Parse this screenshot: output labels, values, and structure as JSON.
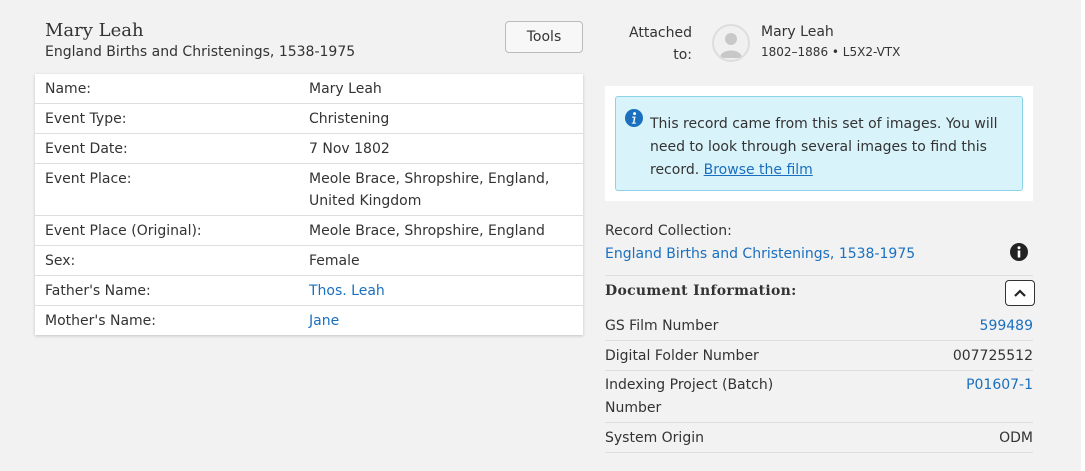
{
  "header": {
    "title": "Mary Leah",
    "subtitle": "England Births and Christenings, 1538-1975",
    "tools_label": "Tools"
  },
  "record": {
    "rows": [
      {
        "label": "Name:",
        "value": "Mary Leah"
      },
      {
        "label": "Event Type:",
        "value": "Christening"
      },
      {
        "label": "Event Date:",
        "value": "7 Nov 1802"
      },
      {
        "label": "Event Place:",
        "value": "Meole Brace, Shropshire, England, United Kingdom"
      },
      {
        "label": "Event Place (Original):",
        "value": "Meole Brace, Shropshire, England"
      },
      {
        "label": "Sex:",
        "value": "Female"
      },
      {
        "label": "Father's Name:",
        "value": "Thos. Leah"
      },
      {
        "label": "Mother's Name:",
        "value": "Jane"
      }
    ]
  },
  "attached": {
    "label_line1": "Attached",
    "label_line2": "to:",
    "person_name": "Mary Leah",
    "person_meta": "1802–1886 • L5X2-VTX"
  },
  "info_notice": {
    "text": "This record came from this set of images. You will need to look through several images to find this record.",
    "link_text": "Browse the film"
  },
  "collection": {
    "label": "Record Collection:",
    "link_text": "England Births and Christenings, 1538-1975"
  },
  "document_info": {
    "heading": "Document Information:",
    "rows": [
      {
        "label": "GS Film Number",
        "value": "599489"
      },
      {
        "label": "Digital Folder Number",
        "value": "007725512"
      },
      {
        "label": "Indexing Project (Batch) Number",
        "value": "P01607-1"
      },
      {
        "label": "System Origin",
        "value": "ODM"
      }
    ]
  },
  "colors": {
    "link": "#1a6fbf",
    "notice_bg": "#d9f3fa",
    "notice_border": "#8dd3e8",
    "page_bg": "#f2f2f2"
  },
  "icons": [
    "person-avatar-icon",
    "info-circle-icon",
    "chevron-up-icon"
  ]
}
